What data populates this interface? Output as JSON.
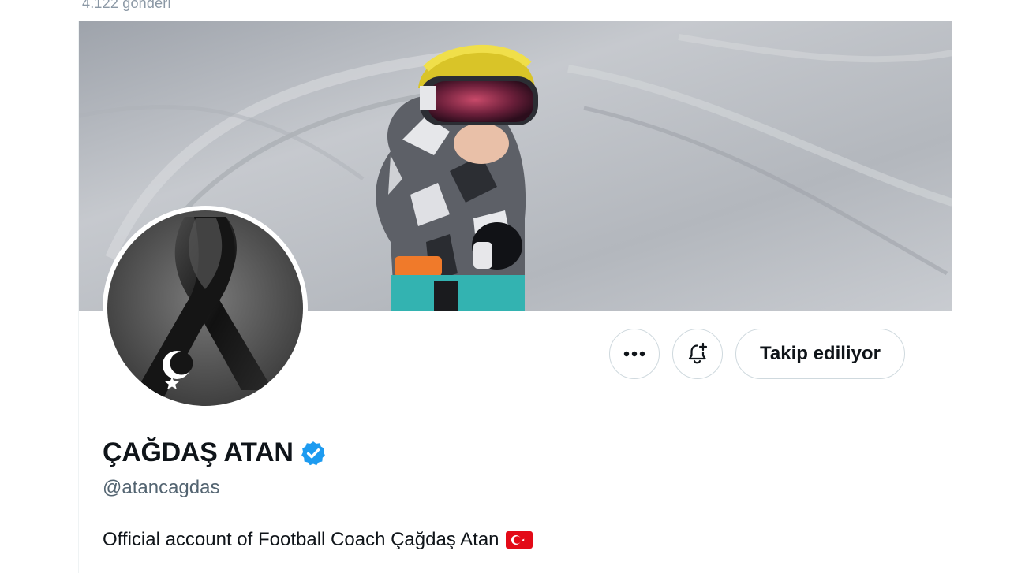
{
  "header": {
    "post_count": "4.122 gönderi"
  },
  "profile": {
    "display_name": "ÇAĞDAŞ ATAN",
    "verified": true,
    "handle": "@atancagdas",
    "bio": "Official account of Football Coach Çağdaş Atan",
    "bio_emoji": "turkey-flag-icon"
  },
  "actions": {
    "more_icon": "more-icon",
    "notify_icon": "bell-plus-icon",
    "follow_label": "Takip ediliyor"
  },
  "colors": {
    "verified_badge": "#1d9bf0",
    "text_primary": "#0f1419",
    "text_secondary": "#536471",
    "button_border": "#cfd9de",
    "flag_red": "#e30a17"
  }
}
